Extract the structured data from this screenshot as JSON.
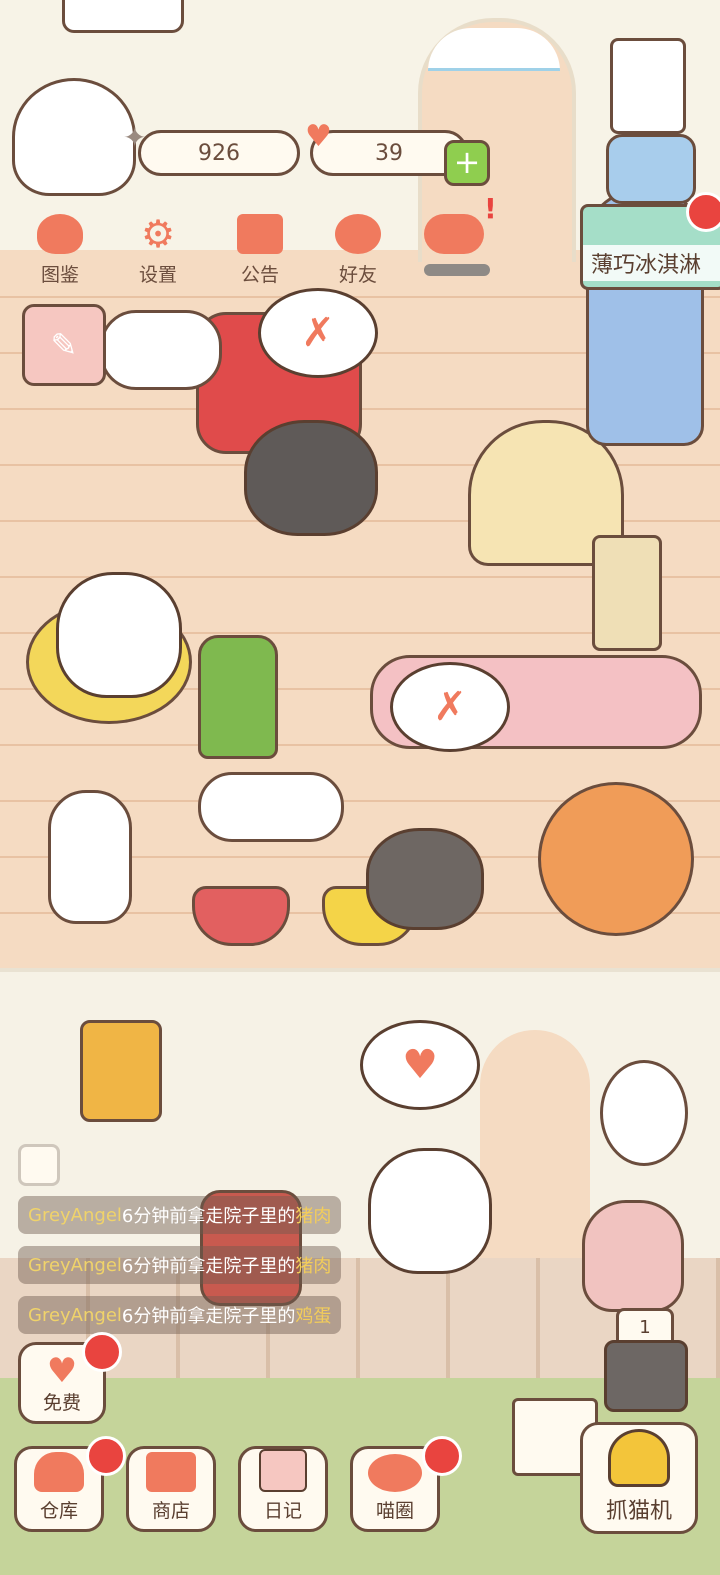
{
  "resources": {
    "fish_count": "926",
    "heart_count": "39"
  },
  "top_menu": [
    {
      "label": "图鉴",
      "icon": "cat-head-icon"
    },
    {
      "label": "设置",
      "icon": "gear-icon"
    },
    {
      "label": "公告",
      "icon": "gift-icon"
    },
    {
      "label": "好友",
      "icon": "friends-icon"
    }
  ],
  "event_banner": {
    "label": "薄巧冰淇淋"
  },
  "feed": [
    {
      "name": "GreyAngel",
      "msg": "6分钟前拿走院子里的",
      "item": "猪肉"
    },
    {
      "name": "GreyAngel",
      "msg": "6分钟前拿走院子里的",
      "item": "猪肉"
    },
    {
      "name": "GreyAngel",
      "msg": "6分钟前拿走院子里的",
      "item": "鸡蛋"
    }
  ],
  "free_button": {
    "label": "免费"
  },
  "bottom_nav": [
    {
      "label": "仓库",
      "icon": "warehouse-icon",
      "badge": true
    },
    {
      "label": "商店",
      "icon": "shop-icon",
      "badge": false
    },
    {
      "label": "日记",
      "icon": "diary-icon",
      "badge": false
    },
    {
      "label": "喵圈",
      "icon": "planet-cat-icon",
      "badge": true
    }
  ],
  "claw_machine": {
    "label": "抓猫机",
    "count": "1"
  },
  "colors": {
    "accent": "#f07a5e",
    "badge": "#e9443f",
    "outline": "#6b4d3d"
  }
}
